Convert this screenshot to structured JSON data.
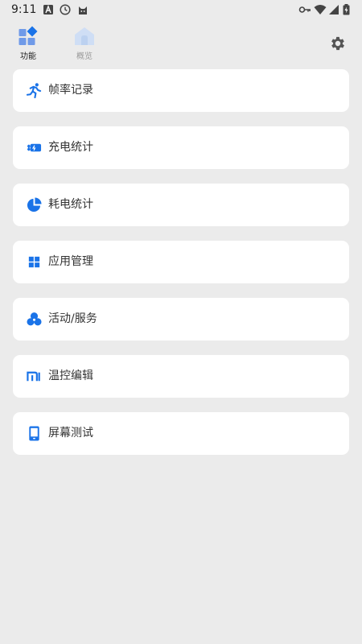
{
  "status_bar": {
    "time": "9:11",
    "left_icons": [
      "a-box-icon",
      "clock-icon",
      "cat-icon"
    ],
    "right_icons": [
      "key-icon",
      "wifi-icon",
      "signal-icon",
      "battery-charging-icon"
    ]
  },
  "tabs": [
    {
      "label": "功能",
      "icon": "grid-diamond-icon",
      "active": true
    },
    {
      "label": "概览",
      "icon": "home-icon",
      "active": false
    }
  ],
  "settings_icon": "gear-icon",
  "accent_color": "#1a73e8",
  "menu_items": [
    {
      "label": "帧率记录",
      "icon": "running-icon"
    },
    {
      "label": "充电统计",
      "icon": "charger-icon"
    },
    {
      "label": "耗电统计",
      "icon": "pie-chart-icon"
    },
    {
      "label": "应用管理",
      "icon": "apps-grid-icon"
    },
    {
      "label": "活动/服务",
      "icon": "bubbles-icon"
    },
    {
      "label": "温控编辑",
      "icon": "mi-logo-icon"
    },
    {
      "label": "屏幕测试",
      "icon": "phone-screen-icon"
    }
  ]
}
